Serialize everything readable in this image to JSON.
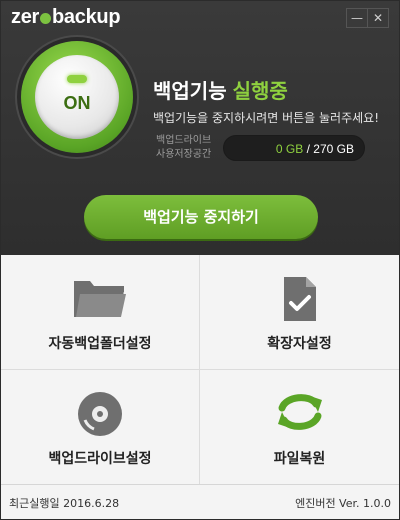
{
  "app": {
    "logo_prefix": "zer",
    "logo_suffix": "backup"
  },
  "window": {
    "minimize_glyph": "—",
    "close_glyph": "✕"
  },
  "status": {
    "power_label": "ON",
    "title_main": "백업기능",
    "title_accent": "실행중",
    "description": "백업기능을 중지하시려면 버튼을 눌러주세요!",
    "storage_label_line1": "백업드라이브",
    "storage_label_line2": "사용저장공간",
    "storage_used": "0 GB",
    "storage_separator": " / ",
    "storage_total": "270 GB"
  },
  "actions": {
    "stop_button": "백업기능 중지하기"
  },
  "menu": [
    {
      "label": "자동백업폴더설정",
      "icon": "folder-icon"
    },
    {
      "label": "확장자설정",
      "icon": "document-check-icon"
    },
    {
      "label": "백업드라이브설정",
      "icon": "disc-icon"
    },
    {
      "label": "파일복원",
      "icon": "restore-arrows-icon"
    }
  ],
  "footer": {
    "last_run": "최근실행일 2016.6.28",
    "engine_version": "엔진버전 Ver. 1.0.0"
  },
  "colors": {
    "accent": "#7cc240",
    "header_bg": "#333333",
    "icon_gray": "#6f6f6f",
    "icon_green": "#5aa526"
  }
}
